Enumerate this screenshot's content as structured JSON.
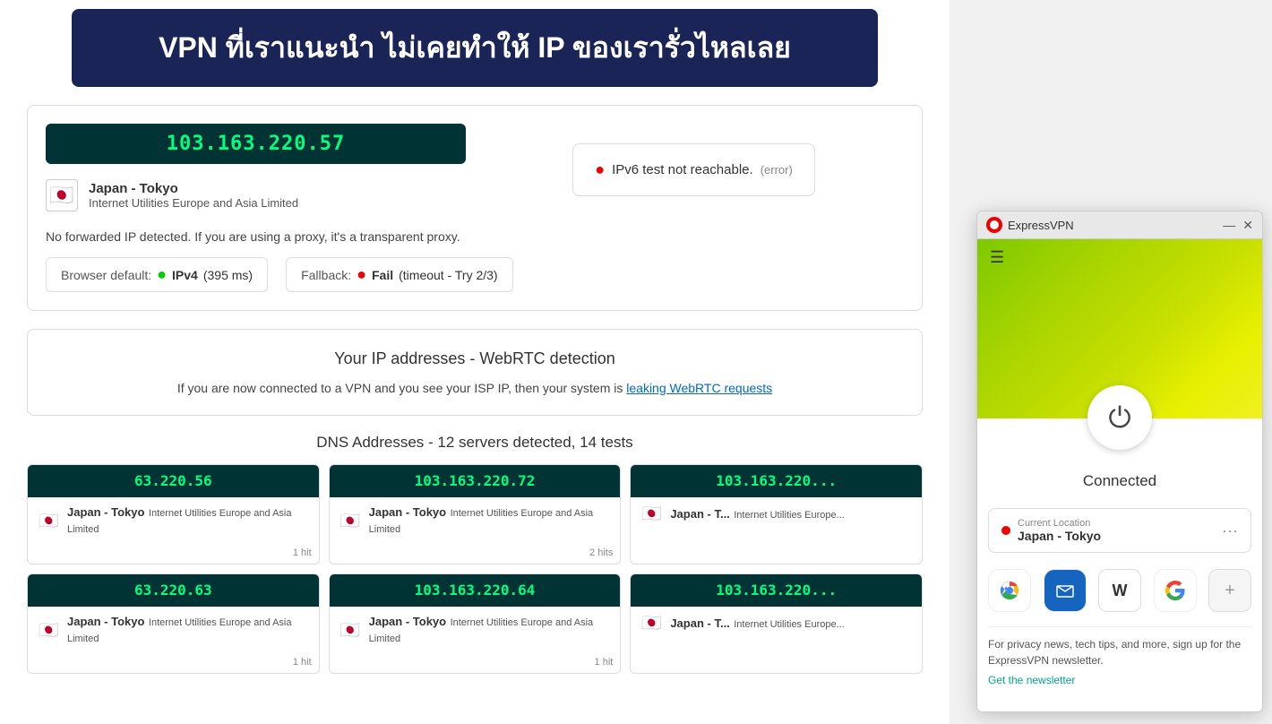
{
  "banner": {
    "text": "VPN ที่เราแนะนำ ไม่เคยทำให้ IP ของเรารั่วไหลเลย"
  },
  "ip_card": {
    "ip_address": "103.163.220.57",
    "location": "Japan - Tokyo",
    "isp": "Internet Utilities Europe and Asia Limited",
    "flag": "🇯🇵",
    "ipv6_label": "IPv6 test not reachable.",
    "ipv6_error": "(error)",
    "forwarded_text": "No forwarded IP detected. If you are using a proxy, it's a transparent proxy.",
    "browser_default_label": "Browser default:",
    "browser_default_protocol": "IPv4",
    "browser_default_time": "(395 ms)",
    "fallback_label": "Fallback:",
    "fallback_value": "Fail",
    "fallback_detail": "(timeout - Try 2/3)"
  },
  "webrtc": {
    "title": "Your IP addresses - WebRTC detection",
    "description": "If you are now connected to a VPN and you see your ISP IP, then your system is",
    "link_text": "leaking WebRTC requests"
  },
  "dns": {
    "title": "DNS Addresses - 12 servers detected, 14 tests",
    "cards": [
      {
        "ip": "63.220.56",
        "ip_prefix": "",
        "full_ip": "...63.220.56",
        "location": "Japan - Tokyo",
        "isp": "Internet Utilities Europe and Asia Limited",
        "hits": "1 hit",
        "flag": "🇯🇵"
      },
      {
        "ip": "103.163.220.72",
        "ip_prefix": "",
        "full_ip": "103.163.220.72",
        "location": "Japan - Tokyo",
        "isp": "Internet Utilities Europe and Asia Limited",
        "hits": "2 hits",
        "flag": "🇯🇵"
      },
      {
        "ip": "103.163.220...",
        "ip_prefix": "",
        "full_ip": "103.163.220...",
        "location": "Japan - T...",
        "isp": "Internet Utilities Europe...",
        "hits": "",
        "flag": "🇯🇵"
      },
      {
        "ip": "63.220.63",
        "ip_prefix": "",
        "full_ip": "...63.220.63",
        "location": "Japan - Tokyo",
        "isp": "Internet Utilities Europe and Asia Limited",
        "hits": "1 hit",
        "flag": "🇯🇵"
      },
      {
        "ip": "103.163.220.64",
        "ip_prefix": "",
        "full_ip": "103.163.220.64",
        "location": "Japan - Tokyo",
        "isp": "Internet Utilities Europe and Asia Limited",
        "hits": "1 hit",
        "flag": "🇯🇵"
      },
      {
        "ip": "103.163.220...",
        "ip_prefix": "",
        "full_ip": "103.163.220...",
        "location": "Japan - T...",
        "isp": "Internet Utilities Europe...",
        "hits": "",
        "flag": "🇯🇵"
      }
    ]
  },
  "expressvpn": {
    "app_name": "ExpressVPN",
    "minimize_label": "—",
    "close_label": "✕",
    "hamburger_label": "☰",
    "status": "Connected",
    "current_location_label": "Current Location",
    "location": "Japan - Tokyo",
    "shortcuts": [
      {
        "name": "Chrome",
        "icon": "🌐",
        "class": "chrome"
      },
      {
        "name": "Gmail",
        "icon": "✉",
        "class": "gmail"
      },
      {
        "name": "Wikipedia",
        "icon": "W",
        "class": "wiki"
      },
      {
        "name": "Google",
        "icon": "G",
        "class": "google"
      },
      {
        "name": "Add",
        "icon": "+",
        "class": "add"
      }
    ],
    "newsletter_text": "For privacy news, tech tips, and more, sign up for the ExpressVPN newsletter.",
    "newsletter_link": "Get the newsletter"
  }
}
